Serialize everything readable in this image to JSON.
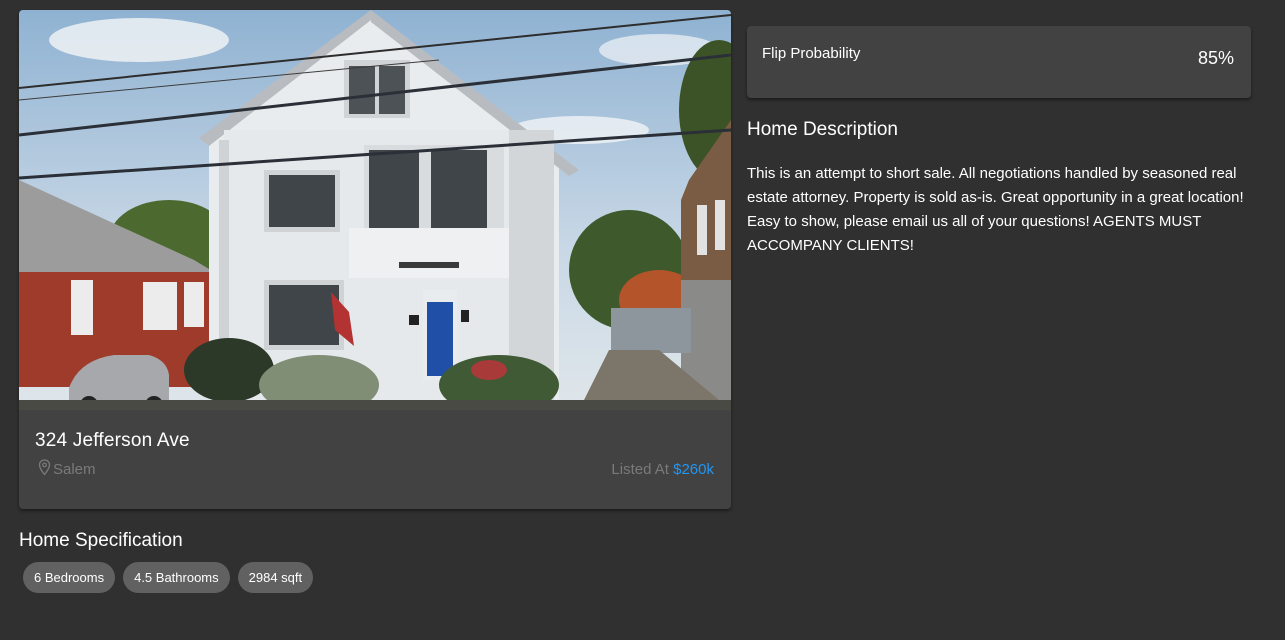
{
  "listing": {
    "address": "324 Jefferson Ave",
    "city": "Salem",
    "listed_prefix": "Listed At",
    "price": "$260k",
    "photo_icon": "house-photo"
  },
  "specification": {
    "title": "Home Specification",
    "chips": [
      "6 Bedrooms",
      "4.5 Bathrooms",
      "2984 sqft"
    ]
  },
  "flip": {
    "label": "Flip Probability",
    "value": "85%"
  },
  "description": {
    "title": "Home Description",
    "text": "This is an attempt to short sale. All negotiations handled by seasoned real estate attorney. Property is sold as-is. Great opportunity in a great location! Easy to show, please email us all of your questions! AGENTS MUST ACCOMPANY CLIENTS!"
  },
  "colors": {
    "background": "#303030",
    "card": "#424242",
    "chip": "#616161",
    "price_accent": "#2196f3",
    "muted_text": "#7a7a7a"
  },
  "icons": {
    "location": "map-pin-icon"
  }
}
